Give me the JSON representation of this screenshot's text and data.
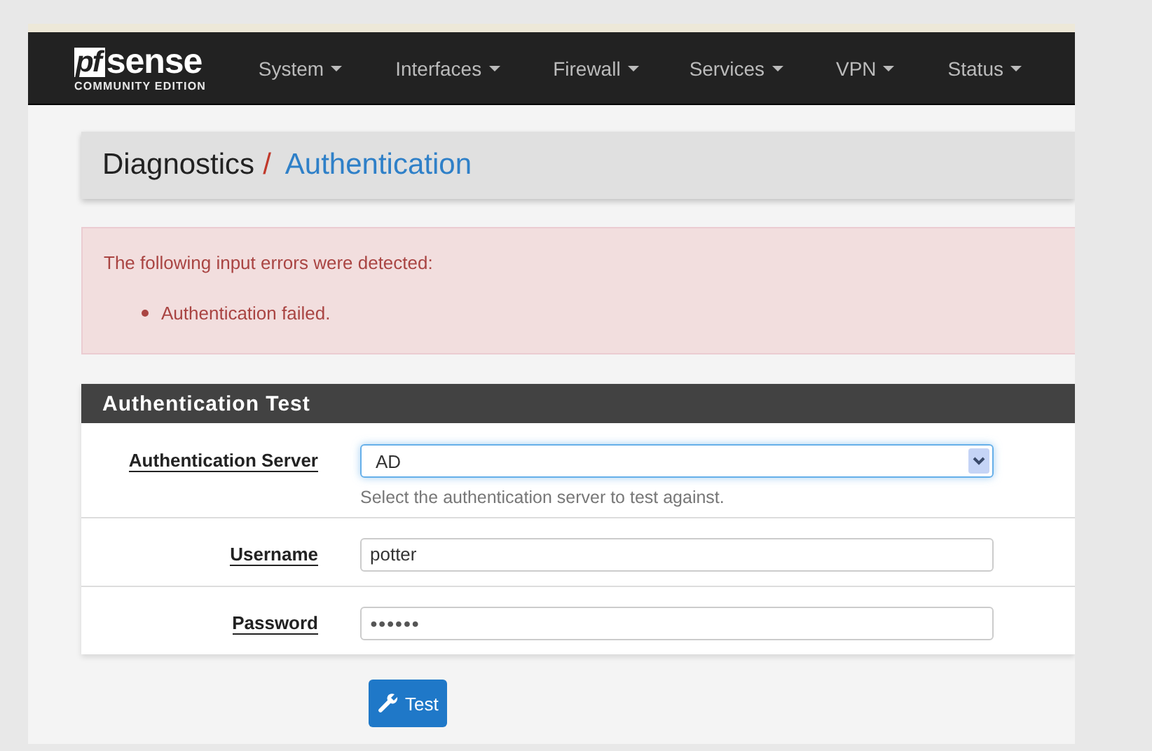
{
  "logo": {
    "mark": "pf",
    "word": "sense",
    "edition": "COMMUNITY EDITION"
  },
  "nav": [
    {
      "label": "System"
    },
    {
      "label": "Interfaces"
    },
    {
      "label": "Firewall"
    },
    {
      "label": "Services"
    },
    {
      "label": "VPN"
    },
    {
      "label": "Status"
    }
  ],
  "breadcrumb": {
    "parent": "Diagnostics",
    "separator": "/",
    "current": "Authentication"
  },
  "alert": {
    "title": "The following input errors were detected:",
    "errors": [
      "Authentication failed."
    ]
  },
  "panel": {
    "title": "Authentication Test",
    "fields": [
      {
        "kind": "select",
        "label": "Authentication Server",
        "value": "AD",
        "help": "Select the authentication server to test against."
      },
      {
        "kind": "text",
        "label": "Username",
        "value": "potter"
      },
      {
        "kind": "password",
        "label": "Password",
        "value": "●●●●●●"
      }
    ]
  },
  "button": {
    "label": "Test"
  }
}
